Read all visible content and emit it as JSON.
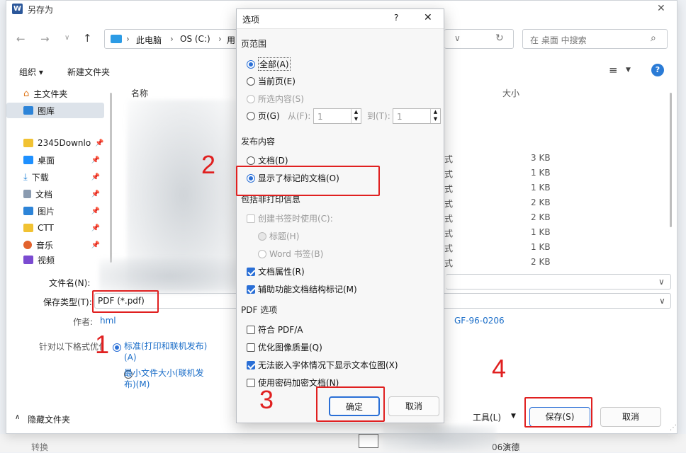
{
  "window": {
    "title": "另存为",
    "app_icon": "W",
    "close": "✕"
  },
  "nav": {
    "breadcrumb": [
      "此电脑",
      "OS (C:)",
      "用"
    ],
    "search_placeholder": "在 桌面 中搜索"
  },
  "toolbar": {
    "organize": "组织 ▾",
    "new_folder": "新建文件夹"
  },
  "sidebar": {
    "items": [
      {
        "label": "主文件夹",
        "icon": "home-icon"
      },
      {
        "label": "图库",
        "icon": "gallery-icon"
      },
      {
        "label": "2345Downlo",
        "icon": "folder-icon"
      },
      {
        "label": "桌面",
        "icon": "desktop-icon"
      },
      {
        "label": "下载",
        "icon": "download-icon"
      },
      {
        "label": "文档",
        "icon": "document-icon"
      },
      {
        "label": "图片",
        "icon": "picture-icon"
      },
      {
        "label": "CTT",
        "icon": "folder-icon"
      },
      {
        "label": "音乐",
        "icon": "music-icon"
      },
      {
        "label": "视频",
        "icon": "video-icon"
      }
    ]
  },
  "file_list": {
    "col_name": "名称",
    "col_size": "大小",
    "rows": [
      {
        "ext": "式",
        "size": "3 KB"
      },
      {
        "ext": "式",
        "size": "1 KB"
      },
      {
        "ext": "式",
        "size": "1 KB"
      },
      {
        "ext": "式",
        "size": "2 KB"
      },
      {
        "ext": "式",
        "size": "2 KB"
      },
      {
        "ext": "式",
        "size": "1 KB"
      },
      {
        "ext": "式",
        "size": "1 KB"
      },
      {
        "ext": "式",
        "size": "2 KB"
      }
    ]
  },
  "form": {
    "filename_label": "文件名(N):",
    "savetype_label": "保存类型(T):",
    "savetype_value": "PDF (*.pdf)",
    "author_label": "作者:",
    "author_value": "hml",
    "tag_value": "GF-96-0206",
    "optimize_label": "针对以下格式优化",
    "opt_standard": "标准(打印和联机发布)(A)",
    "opt_min": "最小文件大小(联机发布)(M)"
  },
  "footer": {
    "hide_folders": "隐藏文件夹",
    "tools": "工具(L)",
    "save": "保存(S)",
    "cancel": "取消"
  },
  "below": {
    "left_text": "转换",
    "right_text": "06演德"
  },
  "dialog": {
    "title": "选项",
    "help": "?",
    "close": "✕",
    "page_range": "页范围",
    "all": "全部(A)",
    "current": "当前页(E)",
    "selection": "所选内容(S)",
    "pages": "页(G)",
    "from": "从(F):",
    "to": "到(T):",
    "from_val": "1",
    "to_val": "1",
    "publish": "发布内容",
    "doc": "文档(D)",
    "doc_markup": "显示了标记的文档(O)",
    "nonprint": "包括非打印信息",
    "bookmarks": "创建书签时使用(C):",
    "headings": "标题(H)",
    "word_bm": "Word 书签(B)",
    "doc_props": "文档属性(R)",
    "a11y": "辅助功能文档结构标记(M)",
    "pdf_opts": "PDF 选项",
    "pdfa": "符合 PDF/A",
    "img_quality": "优化图像质量(Q)",
    "bitmap": "无法嵌入字体情况下显示文本位图(X)",
    "encrypt": "使用密码加密文档(N)",
    "ok": "确定",
    "cancel": "取消"
  },
  "annotations": [
    "1",
    "2",
    "3",
    "4"
  ],
  "colors": {
    "accent": "#2a6fd6",
    "annotation_red": "#e02020",
    "link_blue": "#1a6dc8"
  }
}
